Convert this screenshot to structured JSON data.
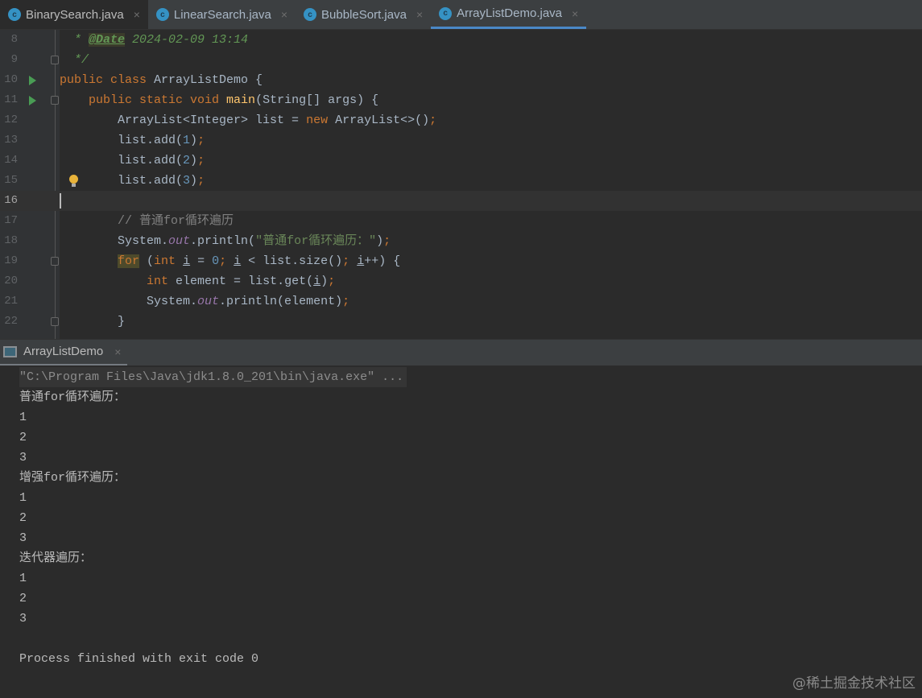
{
  "tabs": [
    {
      "label": "BinarySearch.java",
      "active": false
    },
    {
      "label": "LinearSearch.java",
      "active": false
    },
    {
      "label": "BubbleSort.java",
      "active": false
    },
    {
      "label": "ArrayListDemo.java",
      "active": true
    }
  ],
  "tab_close": "×",
  "class_icon_letter": "c",
  "editor": {
    "current_line": 16,
    "lines": [
      {
        "n": "8",
        "tokens": [
          [
            "  * ",
            "doc"
          ],
          [
            "@Date",
            "tag"
          ],
          [
            " 2024-02-09 13:14",
            "doc"
          ]
        ]
      },
      {
        "n": "9",
        "fold": true,
        "tokens": [
          [
            "  */",
            "doc"
          ]
        ]
      },
      {
        "n": "10",
        "run": true,
        "tokens": [
          [
            "public class ",
            "kw"
          ],
          [
            "ArrayListDemo {",
            ""
          ]
        ]
      },
      {
        "n": "11",
        "run": true,
        "fold": true,
        "tokens": [
          [
            "    public static void ",
            "kw"
          ],
          [
            "main",
            "mth"
          ],
          [
            "(String[] args) {",
            ""
          ]
        ]
      },
      {
        "n": "12",
        "tokens": [
          [
            "        ArrayList<Integer> list = ",
            ""
          ],
          [
            "new ",
            "kw"
          ],
          [
            "ArrayList<>()",
            ""
          ],
          [
            ";",
            "kw"
          ]
        ]
      },
      {
        "n": "13",
        "tokens": [
          [
            "        list.add(",
            ""
          ],
          [
            "1",
            "num"
          ],
          [
            ")",
            ""
          ],
          [
            ";",
            "kw"
          ]
        ]
      },
      {
        "n": "14",
        "tokens": [
          [
            "        list.add(",
            ""
          ],
          [
            "2",
            "num"
          ],
          [
            ")",
            ""
          ],
          [
            ";",
            "kw"
          ]
        ]
      },
      {
        "n": "15",
        "bulb": true,
        "tokens": [
          [
            "        list.add(",
            ""
          ],
          [
            "3",
            "num"
          ],
          [
            ")",
            ""
          ],
          [
            ";",
            "kw"
          ]
        ]
      },
      {
        "n": "16",
        "tokens": []
      },
      {
        "n": "17",
        "tokens": [
          [
            "        // 普通for循环遍历",
            "cmt"
          ]
        ]
      },
      {
        "n": "18",
        "tokens": [
          [
            "        System.",
            ""
          ],
          [
            "out",
            "fld"
          ],
          [
            ".println(",
            ""
          ],
          [
            "\"普通for循环遍历：\"",
            "str"
          ],
          [
            ")",
            ""
          ],
          [
            ";",
            "kw"
          ]
        ]
      },
      {
        "n": "19",
        "fold": true,
        "tokens": [
          [
            "        ",
            ""
          ],
          [
            "for",
            "kw hl"
          ],
          [
            " (",
            ""
          ],
          [
            "int ",
            "kw"
          ],
          [
            "i",
            "var"
          ],
          [
            " = ",
            ""
          ],
          [
            "0",
            "num"
          ],
          [
            "; ",
            "kw"
          ],
          [
            "i",
            "var"
          ],
          [
            " < list.size()",
            ""
          ],
          [
            "; ",
            "kw"
          ],
          [
            "i",
            "var"
          ],
          [
            "++) {",
            ""
          ]
        ]
      },
      {
        "n": "20",
        "tokens": [
          [
            "            ",
            ""
          ],
          [
            "int ",
            "kw"
          ],
          [
            "element = list.get(",
            ""
          ],
          [
            "i",
            "var"
          ],
          [
            ")",
            ""
          ],
          [
            ";",
            "kw"
          ]
        ]
      },
      {
        "n": "21",
        "tokens": [
          [
            "            System.",
            ""
          ],
          [
            "out",
            "fld"
          ],
          [
            ".println(element)",
            ""
          ],
          [
            ";",
            "kw"
          ]
        ]
      },
      {
        "n": "22",
        "fold": true,
        "tokens": [
          [
            "        }",
            ""
          ]
        ]
      }
    ]
  },
  "console": {
    "tab_label": "ArrayListDemo",
    "lines": [
      "\"C:\\Program Files\\Java\\jdk1.8.0_201\\bin\\java.exe\" ...",
      "普通for循环遍历：",
      "1",
      "2",
      "3",
      "增强for循环遍历：",
      "1",
      "2",
      "3",
      "迭代器遍历：",
      "1",
      "2",
      "3",
      "",
      "Process finished with exit code 0"
    ]
  },
  "watermark": "@稀土掘金技术社区",
  "colors": {
    "keyword": "#cc7832",
    "string": "#6a8759",
    "comment": "#808080",
    "number": "#6897bb",
    "field": "#9876aa",
    "method": "#ffc66d",
    "text": "#a9b7c6",
    "accent": "#4a88c7"
  }
}
